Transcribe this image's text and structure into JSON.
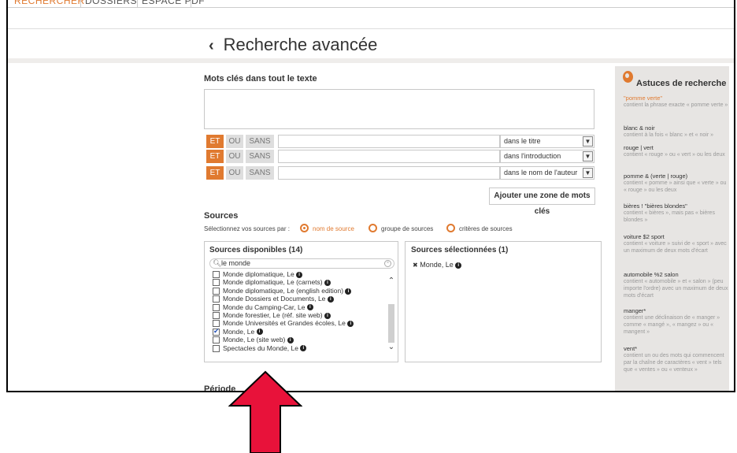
{
  "nav": {
    "tabs": [
      "RECHERCHER",
      "DOSSIERS",
      "ESPACE PDF"
    ]
  },
  "page": {
    "back_icon": "‹",
    "title": "Recherche avancée"
  },
  "keywords": {
    "label": "Mots clés dans tout le texte",
    "rows": [
      {
        "et": "ET",
        "ou": "OU",
        "sans": "SANS",
        "scope": "dans le titre"
      },
      {
        "et": "ET",
        "ou": "OU",
        "sans": "SANS",
        "scope": "dans l'introduction"
      },
      {
        "et": "ET",
        "ou": "OU",
        "sans": "SANS",
        "scope": "dans le nom de l'auteur"
      }
    ],
    "add_button": "Ajouter une zone de mots clés"
  },
  "sources": {
    "label": "Sources",
    "select_by": "Sélectionnez vos sources par :",
    "options": [
      "nom de source",
      "groupe de sources",
      "critères de sources"
    ],
    "selected_option": "nom de source",
    "available_title": "Sources disponibles (14)",
    "search_value": "le monde",
    "list": [
      {
        "name": "Monde diplomatique, Le",
        "checked": false
      },
      {
        "name": "Monde diplomatique, Le (carnets)",
        "checked": false
      },
      {
        "name": "Monde diplomatique, Le (english edition)",
        "checked": false
      },
      {
        "name": "Monde Dossiers et Documents, Le",
        "checked": false
      },
      {
        "name": "Monde du Camping-Car, Le",
        "checked": false
      },
      {
        "name": "Monde forestier, Le (réf. site web)",
        "checked": false
      },
      {
        "name": "Monde Universités et Grandes écoles, Le",
        "checked": false
      },
      {
        "name": "Monde, Le",
        "checked": true
      },
      {
        "name": "Monde, Le (site web)",
        "checked": false
      },
      {
        "name": "Spectacles du Monde, Le",
        "checked": false
      }
    ],
    "selected_title": "Sources sélectionnées (1)",
    "selected": [
      "Monde, Le"
    ]
  },
  "periode": {
    "label": "Période"
  },
  "tips": {
    "title": "Astuces de recherche",
    "items": [
      {
        "term": "\"pomme verte\"",
        "desc": "contient la phrase exacte « pomme verte »"
      },
      {
        "term": "blanc & noir",
        "desc": "contient à la fois « blanc » et « noir »"
      },
      {
        "term": "rouge | vert",
        "desc": "contient « rouge » ou « vert » ou les deux"
      },
      {
        "term": "pomme & (verte | rouge)",
        "desc": "contient « pomme » ainsi que « verte » ou « rouge » ou les deux"
      },
      {
        "term": "bières ! \"bières blondes\"",
        "desc": "contient « bières », mais pas « bières blondes »"
      },
      {
        "term": "voiture $2 sport",
        "desc": "contient « voiture » suivi de « sport » avec un maximum de deux mots d'écart"
      },
      {
        "term": "automobile %2 salon",
        "desc": "contient « automobile » et « salon » (peu importe l'ordre) avec un maximum de deux mots d'écart"
      },
      {
        "term": "manger*",
        "desc": "contient une déclinaison de « manger » comme « mangé », « mangez » ou « mangent »"
      },
      {
        "term": "vent*",
        "desc": "contient un ou des mots qui commencent par la chaîne de caractères « vent » tels que « ventes » ou « venteux »"
      }
    ]
  },
  "colors": {
    "accent": "#e07a30",
    "arrow": "#e8123a",
    "sidebar_bg": "#e7e5e3"
  }
}
